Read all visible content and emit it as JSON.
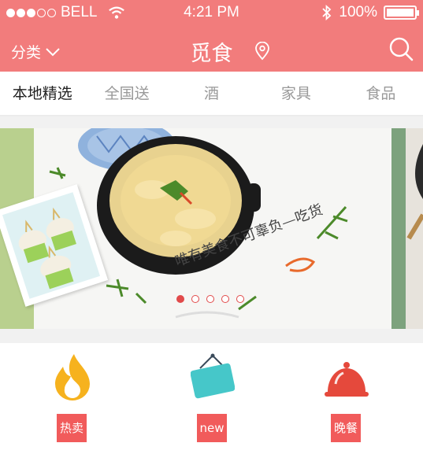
{
  "status_bar": {
    "carrier": "BELL",
    "time": "4:21 PM",
    "battery": "100%",
    "signal_bars_filled": 3,
    "signal_bars_total": 5
  },
  "nav": {
    "category_label": "分类",
    "title": "觅食"
  },
  "tabs": [
    {
      "label": "本地精选",
      "active": true
    },
    {
      "label": "全国送",
      "active": false
    },
    {
      "label": "酒",
      "active": false
    },
    {
      "label": "家具",
      "active": false
    },
    {
      "label": "食品",
      "active": false
    }
  ],
  "banner": {
    "caption": "唯有美食不可辜负—吃货",
    "slide_count": 5,
    "active_slide": 1
  },
  "categories": [
    {
      "badge": "热卖",
      "icon": "flame-icon"
    },
    {
      "badge": "new",
      "icon": "sign-icon"
    },
    {
      "badge": "晚餐",
      "icon": "cloche-icon"
    }
  ],
  "colors": {
    "header": "#f27c7c",
    "accent": "#f15b5b",
    "flame": "#f6b21e",
    "sign": "#46c7c9",
    "cloche": "#e5493c"
  }
}
